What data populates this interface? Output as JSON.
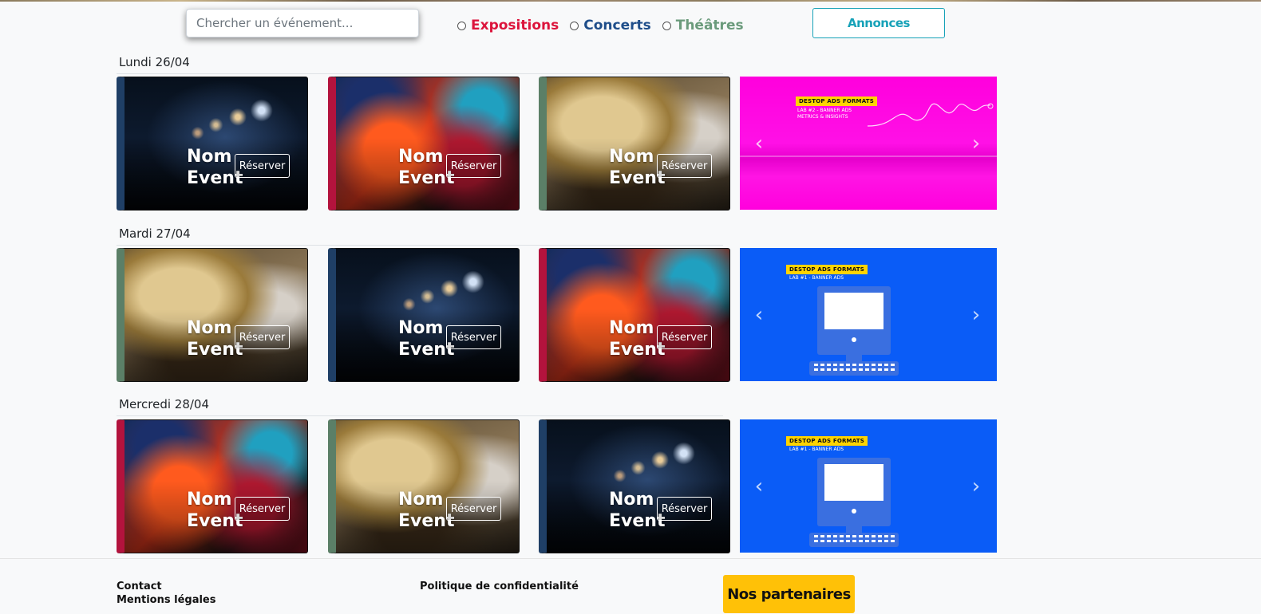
{
  "search": {
    "placeholder": "Chercher un événement..."
  },
  "filters": [
    {
      "label": "Expositions",
      "color": "#dc143c"
    },
    {
      "label": "Concerts",
      "color": "#1f4e8a"
    },
    {
      "label": "Théâtres",
      "color": "#6b9b7c"
    }
  ],
  "header": {
    "annonces_label": "Annonces"
  },
  "days": [
    {
      "label": "Lundi 26/04",
      "events": [
        {
          "category": "concert",
          "image": "concert-lights",
          "accent": "#1f3f66",
          "name": "Nom\nEvent",
          "button": "Réserver"
        },
        {
          "category": "exposition",
          "image": "abstract-painting",
          "accent": "#b3133d",
          "name": "Nom\nEvent",
          "button": "Réserver"
        },
        {
          "category": "theatre",
          "image": "venetian-mask",
          "accent": "#5b7f67",
          "name": "Nom\nEvent",
          "button": "Réserver"
        }
      ],
      "ad": {
        "style": "pink",
        "tag": "DESTOP ADS FORMATS",
        "sub1": "LAB #2 - BANNER ADS",
        "sub2": "METRICS & INSIGHTS",
        "prev_icon": "chevron-left",
        "next_icon": "chevron-right"
      }
    },
    {
      "label": "Mardi 27/04",
      "events": [
        {
          "category": "theatre",
          "image": "venetian-mask",
          "accent": "#5b7f67",
          "name": "Nom\nEvent",
          "button": "Réserver"
        },
        {
          "category": "concert",
          "image": "concert-lights",
          "accent": "#1f3f66",
          "name": "Nom\nEvent",
          "button": "Réserver"
        },
        {
          "category": "exposition",
          "image": "abstract-painting",
          "accent": "#b3133d",
          "name": "Nom\nEvent",
          "button": "Réserver"
        }
      ],
      "ad": {
        "style": "blue",
        "tag": "DESTOP ADS FORMATS",
        "sub1": "LAB #1 - BANNER ADS",
        "sub2": "",
        "prev_icon": "chevron-left",
        "next_icon": "chevron-right"
      }
    },
    {
      "label": "Mercredi 28/04",
      "events": [
        {
          "category": "exposition",
          "image": "abstract-painting",
          "accent": "#b3133d",
          "name": "Nom\nEvent",
          "button": "Réserver"
        },
        {
          "category": "theatre",
          "image": "venetian-mask",
          "accent": "#5b7f67",
          "name": "Nom\nEvent",
          "button": "Réserver"
        },
        {
          "category": "concert",
          "image": "concert-lights",
          "accent": "#1f3f66",
          "name": "Nom\nEvent",
          "button": "Réserver"
        }
      ],
      "ad": {
        "style": "blue",
        "tag": "DESTOP ADS FORMATS",
        "sub1": "LAB #1 - BANNER ADS",
        "sub2": "",
        "prev_icon": "chevron-left",
        "next_icon": "chevron-right"
      }
    }
  ],
  "footer": {
    "contact": "Contact",
    "mentions": "Mentions légales",
    "privacy": "Politique de confidentialité",
    "partners_label": "Nos partenaires"
  }
}
